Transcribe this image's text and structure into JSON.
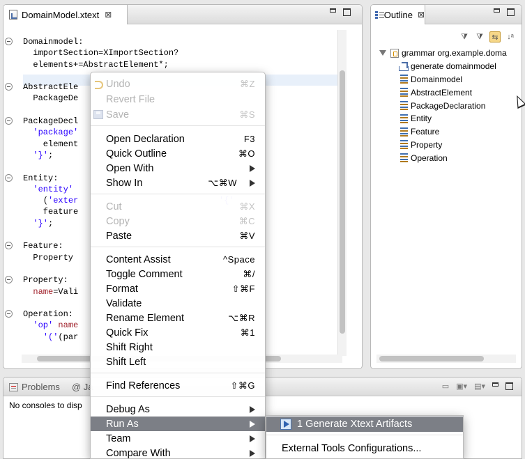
{
  "editor": {
    "tab_title": "DomainModel.xtext",
    "code_lines": [
      [
        {
          "t": "Domainmodel:",
          "c": ""
        }
      ],
      [
        {
          "t": "  importSection=XImportSection?",
          "c": ""
        }
      ],
      [
        {
          "t": "  elements+=AbstractElement*;",
          "c": ""
        }
      ],
      [
        {
          "t": "",
          "c": ""
        }
      ],
      [
        {
          "t": "AbstractEle",
          "c": ""
        }
      ],
      [
        {
          "t": "  PackageDe",
          "c": ""
        }
      ],
      [
        {
          "t": "",
          "c": ""
        }
      ],
      [
        {
          "t": "PackageDecl",
          "c": ""
        }
      ],
      [
        {
          "t": "  ",
          "c": ""
        },
        {
          "t": "'package'",
          "c": "kw"
        }
      ],
      [
        {
          "t": "    element",
          "c": ""
        }
      ],
      [
        {
          "t": "  ",
          "c": ""
        },
        {
          "t": "'}'",
          "c": "kw"
        },
        {
          "t": ";",
          "c": ""
        }
      ],
      [
        {
          "t": "",
          "c": ""
        }
      ],
      [
        {
          "t": "Entity:",
          "c": ""
        }
      ],
      [
        {
          "t": "  ",
          "c": ""
        },
        {
          "t": "'entity'",
          "c": "kw"
        }
      ],
      [
        {
          "t": "    (",
          "c": ""
        },
        {
          "t": "'exter",
          "c": "kw"
        },
        {
          "t": "                            ",
          "c": ""
        },
        {
          "t": "'{'",
          "c": "kw"
        }
      ],
      [
        {
          "t": "    feature",
          "c": ""
        }
      ],
      [
        {
          "t": "  ",
          "c": ""
        },
        {
          "t": "'}'",
          "c": "kw"
        },
        {
          "t": ";",
          "c": ""
        }
      ],
      [
        {
          "t": "",
          "c": ""
        }
      ],
      [
        {
          "t": "Feature:",
          "c": ""
        }
      ],
      [
        {
          "t": "  Property",
          "c": ""
        }
      ],
      [
        {
          "t": "",
          "c": ""
        }
      ],
      [
        {
          "t": "Property:",
          "c": ""
        }
      ],
      [
        {
          "t": "  ",
          "c": ""
        },
        {
          "t": "name",
          "c": "red"
        },
        {
          "t": "=Vali",
          "c": ""
        }
      ],
      [
        {
          "t": "",
          "c": ""
        }
      ],
      [
        {
          "t": "Operation:",
          "c": ""
        }
      ],
      [
        {
          "t": "  ",
          "c": ""
        },
        {
          "t": "'op'",
          "c": "kw"
        },
        {
          "t": " ",
          "c": ""
        },
        {
          "t": "name",
          "c": "red"
        }
      ],
      [
        {
          "t": "    ",
          "c": ""
        },
        {
          "t": "'('",
          "c": "kw"
        },
        {
          "t": "(par",
          "c": ""
        }
      ]
    ]
  },
  "outline": {
    "tab_title": "Outline",
    "root": "grammar org.example.doma",
    "items": [
      "generate domainmodel",
      "Domainmodel",
      "AbstractElement",
      "PackageDeclaration",
      "Entity",
      "Feature",
      "Property",
      "Operation"
    ]
  },
  "bottom": {
    "tab_problems": "Problems",
    "tab_partial": "@ Ja",
    "console_text": "No consoles to disp"
  },
  "context_menu": {
    "undo": {
      "label": "Undo",
      "shortcut": "⌘Z"
    },
    "revert": {
      "label": "Revert File"
    },
    "save": {
      "label": "Save",
      "shortcut": "⌘S"
    },
    "open_declaration": {
      "label": "Open Declaration",
      "shortcut": "F3"
    },
    "quick_outline": {
      "label": "Quick Outline",
      "shortcut": "⌘O"
    },
    "open_with": {
      "label": "Open With"
    },
    "show_in": {
      "label": "Show In",
      "shortcut": "⌥⌘W"
    },
    "cut": {
      "label": "Cut",
      "shortcut": "⌘X"
    },
    "copy": {
      "label": "Copy",
      "shortcut": "⌘C"
    },
    "paste": {
      "label": "Paste",
      "shortcut": "⌘V"
    },
    "content_assist": {
      "label": "Content Assist",
      "shortcut": "^Space"
    },
    "toggle_comment": {
      "label": "Toggle Comment",
      "shortcut": "⌘/"
    },
    "format": {
      "label": "Format",
      "shortcut": "⇧⌘F"
    },
    "validate": {
      "label": "Validate"
    },
    "rename_element": {
      "label": "Rename Element",
      "shortcut": "⌥⌘R"
    },
    "quick_fix": {
      "label": "Quick Fix",
      "shortcut": "⌘1"
    },
    "shift_right": {
      "label": "Shift Right"
    },
    "shift_left": {
      "label": "Shift Left"
    },
    "find_references": {
      "label": "Find References",
      "shortcut": "⇧⌘G"
    },
    "debug_as": {
      "label": "Debug As"
    },
    "run_as": {
      "label": "Run As"
    },
    "team": {
      "label": "Team"
    },
    "compare_with": {
      "label": "Compare With"
    }
  },
  "submenu": {
    "generate": "1 Generate Xtext Artifacts",
    "external_tools": "External Tools Configurations..."
  },
  "colors": {
    "highlight": "#7c7f86",
    "keyword": "#2a00ff",
    "feature": "#a0202a"
  }
}
